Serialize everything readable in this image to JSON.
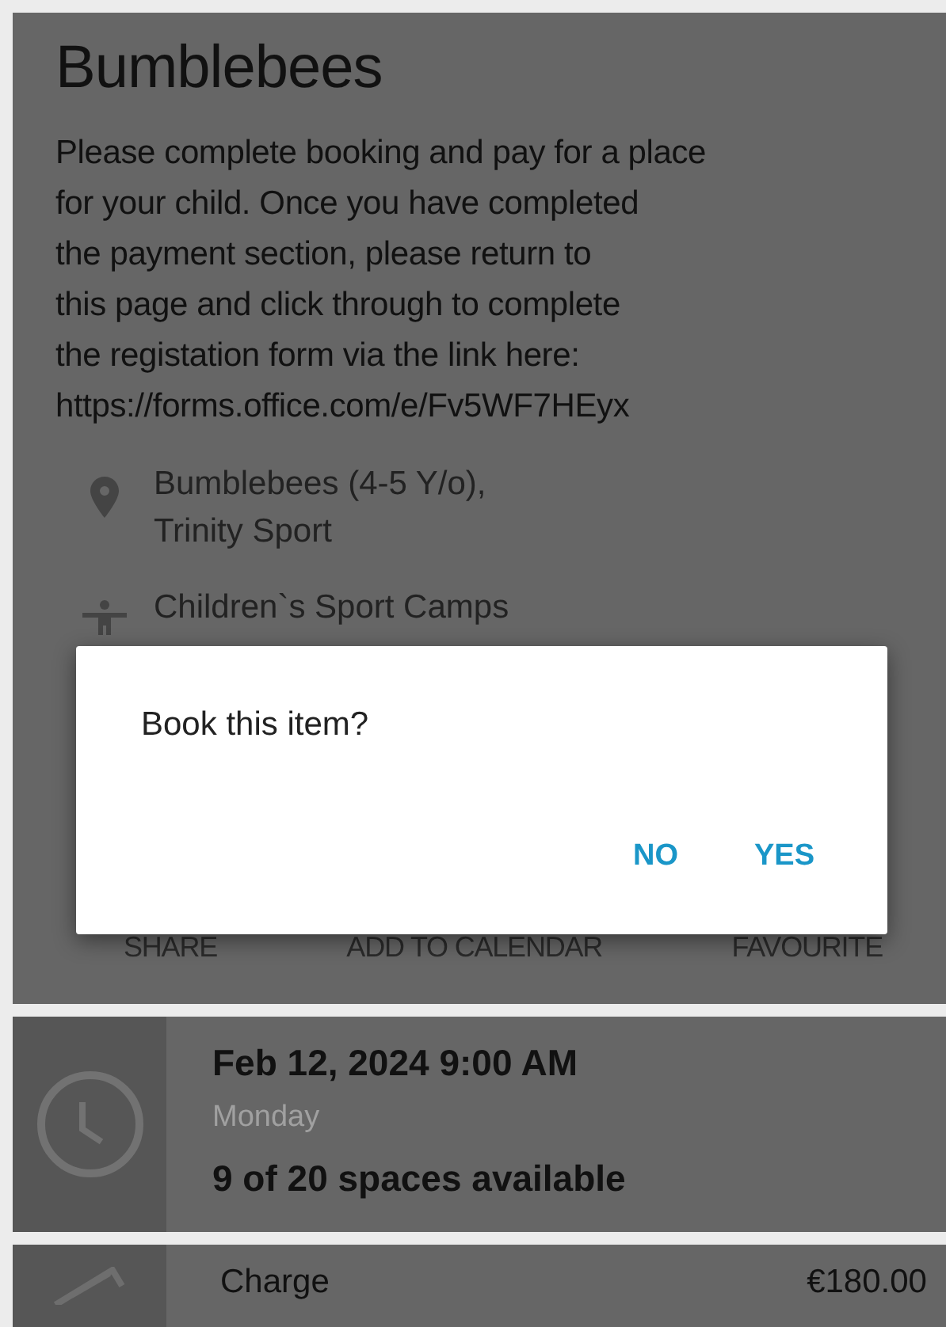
{
  "event": {
    "title": "Bumblebees",
    "description_lines": [
      "Please complete booking and pay for a place",
      "for your child. Once you have completed",
      "the payment section, please return to",
      "this page and click through to complete",
      "the registation form via the link here:",
      "https://forms.office.com/e/Fv5WF7HEyx"
    ],
    "details": [
      {
        "kind": "location",
        "lines": [
          "Bumblebees (4-5 Y/o),",
          "Trinity Sport"
        ]
      },
      {
        "kind": "category",
        "lines": [
          "Children`s Sport Camps"
        ]
      }
    ],
    "actions": [
      "SHARE",
      "ADD TO CALENDAR",
      "FAVOURITE"
    ]
  },
  "dialog": {
    "message": "Book this item?",
    "buttons": [
      "NO",
      "YES"
    ]
  },
  "session": {
    "datetime": "Feb 12, 2024 9:00 AM",
    "weekday": "Monday",
    "availability": "9 of 20 spaces available"
  },
  "charge": {
    "label": "Charge",
    "amount": "€180.00"
  }
}
